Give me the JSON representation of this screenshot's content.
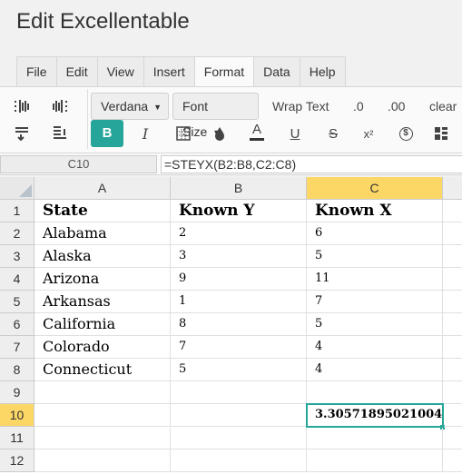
{
  "app": {
    "title": "Edit Excellentable"
  },
  "menu": [
    "File",
    "Edit",
    "View",
    "Insert",
    "Format",
    "Data",
    "Help"
  ],
  "menu_active": "Format",
  "toolbar": {
    "font_family": "Verdana",
    "font_size": "Font Size",
    "wrap_text": "Wrap Text",
    "decrease_decimal": ".0",
    "increase_decimal": ".00",
    "clear": "clear",
    "bold": "B",
    "italic": "I",
    "text_color": "A",
    "underline": "U",
    "strikethrough": "S",
    "superscript": "x²",
    "currency": "$"
  },
  "formula_bar": {
    "cell_ref": "C10",
    "formula": "=STEYX(B2:B8,C2:C8)"
  },
  "grid": {
    "columns": [
      "A",
      "B",
      "C"
    ],
    "rows": [
      "1",
      "2",
      "3",
      "4",
      "5",
      "6",
      "7",
      "8",
      "9",
      "10",
      "11",
      "12"
    ],
    "cells": {
      "A1": "State",
      "B1": "Known Y",
      "C1": "Known X",
      "A2": "Alabama",
      "B2": "2",
      "C2": "6",
      "A3": "Alaska",
      "B3": "3",
      "C3": "5",
      "A4": "Arizona",
      "B4": "9",
      "C4": "11",
      "A5": "Arkansas",
      "B5": "1",
      "C5": "7",
      "A6": "California",
      "B6": "8",
      "C6": "5",
      "A7": "Colorado",
      "B7": "7",
      "C7": "4",
      "A8": "Connecticut",
      "B8": "5",
      "C8": "4",
      "C10": "3.30571895021004"
    }
  },
  "colors": {
    "accent": "#26a69a",
    "selected_header": "#fcd765"
  }
}
